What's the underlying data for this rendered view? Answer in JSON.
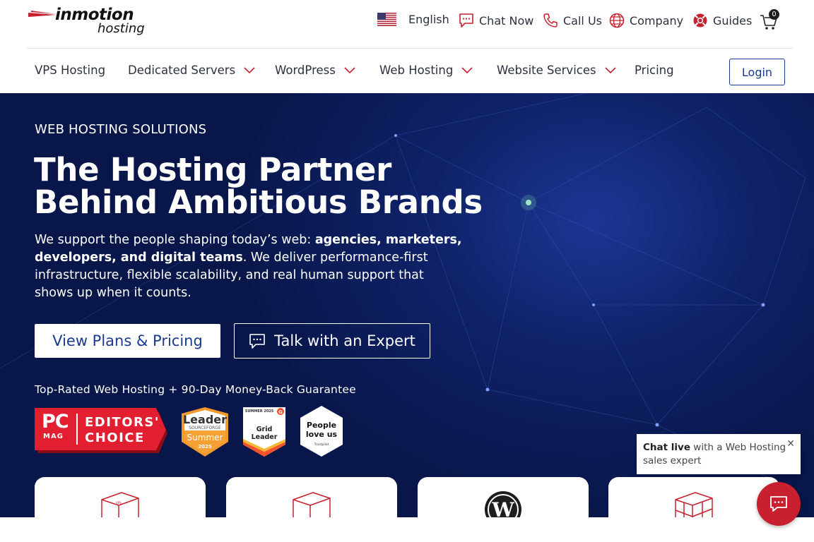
{
  "brand": {
    "wordmark": "inmotion",
    "sub": "hosting"
  },
  "utility": {
    "language": "English",
    "chat": "Chat Now",
    "call": "Call Us",
    "company": "Company",
    "guides": "Guides",
    "cart_count": "0"
  },
  "nav": {
    "items": [
      {
        "label": "VPS Hosting",
        "dropdown": false
      },
      {
        "label": "Dedicated Servers",
        "dropdown": true
      },
      {
        "label": "WordPress",
        "dropdown": true
      },
      {
        "label": "Web Hosting",
        "dropdown": true
      },
      {
        "label": "Website Services",
        "dropdown": true
      },
      {
        "label": "Pricing",
        "dropdown": false
      }
    ],
    "login": "Login"
  },
  "hero": {
    "eyebrow": "WEB HOSTING SOLUTIONS",
    "headline": "The Hosting Partner Behind Ambitious Brands",
    "lede_start": "We support the people shaping today’s web: ",
    "lede_bold": "agencies, marketers, developers, and digital teams",
    "lede_end": ". We deliver performance-first infrastructure, flexible scalability, and real human support that shows up when it counts.",
    "primary_cta": "View Plans & Pricing",
    "secondary_cta": "Talk with an Expert",
    "guarantee": "Top-Rated Web Hosting + 90-Day Money-Back Guarantee"
  },
  "badges": {
    "pcmag": {
      "logo": "PC",
      "mag": "MAG",
      "line1": "EDITORS'",
      "line2": "CHOICE"
    },
    "sourceforge": {
      "title": "Leader",
      "brand": "SOURCEFORGE",
      "season": "Summer",
      "year": "2025"
    },
    "g2": {
      "season": "SUMMER 2025",
      "title": "Grid Leader"
    },
    "trustpilot": {
      "line1": "People",
      "line2": "love us",
      "brand": "Trustpilot"
    }
  },
  "chat_tip": {
    "bold": "Chat live",
    "rest": " with a Web Hosting sales expert"
  },
  "colors": {
    "brand_blue": "#1a3a8f",
    "hero_bg": "#0f2268",
    "accent_red": "#c8202f"
  }
}
